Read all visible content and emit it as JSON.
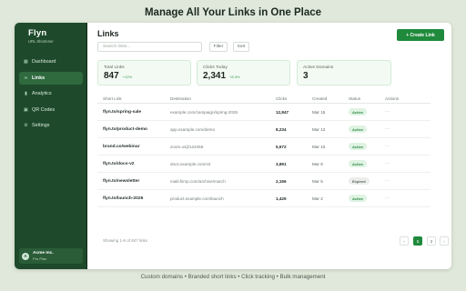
{
  "headline": "Manage All Your Links in One Place",
  "footer": "Custom domains • Branded short links • Click tracking • Bulk management",
  "sidebar": {
    "brand": "Flyn",
    "tagline": "URL Shortener",
    "items": [
      {
        "label": "Dashboard",
        "icon": "dashboard-icon",
        "glyph": "▦",
        "active": false
      },
      {
        "label": "Links",
        "icon": "link-icon",
        "glyph": "∞",
        "active": true
      },
      {
        "label": "Analytics",
        "icon": "analytics-icon",
        "glyph": "▮",
        "active": false
      },
      {
        "label": "QR Codes",
        "icon": "qr-code-icon",
        "glyph": "▣",
        "active": false
      },
      {
        "label": "Settings",
        "icon": "gear-icon",
        "glyph": "⚙",
        "active": false
      }
    ],
    "org": {
      "avatar": "A",
      "name": "Acme Inc.",
      "plan": "Pro Plan"
    }
  },
  "main": {
    "title": "Links",
    "create_label": "+ Create Link",
    "search_placeholder": "Search links...",
    "filter_label": "Filter",
    "sort_label": "Sort",
    "stats": [
      {
        "label": "Total Links",
        "value": "847",
        "delta": "+12%"
      },
      {
        "label": "Clicks Today",
        "value": "2,341",
        "delta": "+8.3%"
      },
      {
        "label": "Active Domains",
        "value": "3",
        "delta": ""
      }
    ],
    "columns": [
      "Short Link",
      "Destination",
      "Clicks",
      "Created",
      "Status",
      "Actions"
    ],
    "rows": [
      {
        "short": "flyn.to/spring-sale",
        "dest": "example.com/campaign/spring-2026",
        "clicks": "12,847",
        "created": "Mar 15",
        "status": "Active",
        "action": "···"
      },
      {
        "short": "flyn.to/product-demo",
        "dest": "app.example.com/demo",
        "clicks": "8,234",
        "created": "Mar 12",
        "status": "Active",
        "action": "···"
      },
      {
        "short": "brand.co/webinar",
        "dest": "zoom.us/j/123456",
        "clicks": "5,672",
        "created": "Mar 10",
        "status": "Active",
        "action": "···"
      },
      {
        "short": "flyn.to/docs-v2",
        "dest": "docs.example.com/v2",
        "clicks": "3,891",
        "created": "Mar 8",
        "status": "Active",
        "action": "···"
      },
      {
        "short": "flyn.to/newsletter",
        "dest": "mailchimp.com/archive/march",
        "clicks": "2,156",
        "created": "Mar 5",
        "status": "Expired",
        "action": "···"
      },
      {
        "short": "flyn.to/launch-2026",
        "dest": "product.example.com/launch",
        "clicks": "1,429",
        "created": "Mar 2",
        "status": "Active",
        "action": "···"
      }
    ],
    "showing": "Showing 1-6 of 847 links",
    "pager": {
      "prev": "‹",
      "current": "1",
      "next_page": "2",
      "next": "›"
    }
  },
  "colors": {
    "accent": "#1f8a3c",
    "sidebar": "#1e4a2b",
    "background": "#dfe8da"
  }
}
